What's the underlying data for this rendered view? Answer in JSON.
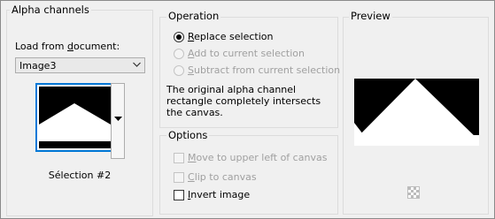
{
  "alpha_channels": {
    "title": "Alpha channels",
    "load_from_label": "Load from document:",
    "load_from_accel": "d",
    "document_value": "Image3",
    "channel_name": "Sélection #2"
  },
  "operation": {
    "title": "Operation",
    "options": [
      {
        "label": "Replace selection",
        "accel": "R",
        "selected": true,
        "enabled": true
      },
      {
        "label": "Add to current selection",
        "accel": "A",
        "selected": false,
        "enabled": false
      },
      {
        "label": "Subtract from current selection",
        "accel": "S",
        "selected": false,
        "enabled": false
      }
    ],
    "info_text": "The original alpha channel rectangle completely intersects the canvas."
  },
  "options": {
    "title": "Options",
    "items": [
      {
        "label": "Move to upper left of canvas",
        "accel": "M",
        "checked": false,
        "enabled": false
      },
      {
        "label": "Clip to canvas",
        "accel": "C",
        "checked": false,
        "enabled": false
      },
      {
        "label": "Invert image",
        "accel": "I",
        "checked": false,
        "enabled": true
      }
    ]
  },
  "preview": {
    "title": "Preview"
  },
  "colors": {
    "accent": "#0078d7",
    "disabled_text": "#a0a0a0"
  }
}
